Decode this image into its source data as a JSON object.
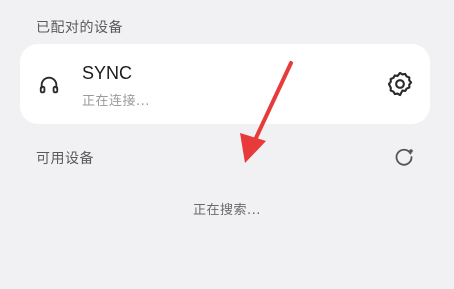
{
  "paired_section": {
    "label": "已配对的设备",
    "devices": [
      {
        "name": "SYNC",
        "status": "正在连接...",
        "icon": "headset-icon"
      }
    ]
  },
  "available_section": {
    "label": "可用设备",
    "searching_text": "正在搜索...",
    "refresh_icon": "refresh-icon"
  },
  "annotation": {
    "arrow_color": "#e83a3a"
  },
  "colors": {
    "background": "#f1f1f3",
    "card": "#ffffff",
    "primary_text": "#1b1b1b",
    "secondary_text": "#9a9a9a"
  }
}
